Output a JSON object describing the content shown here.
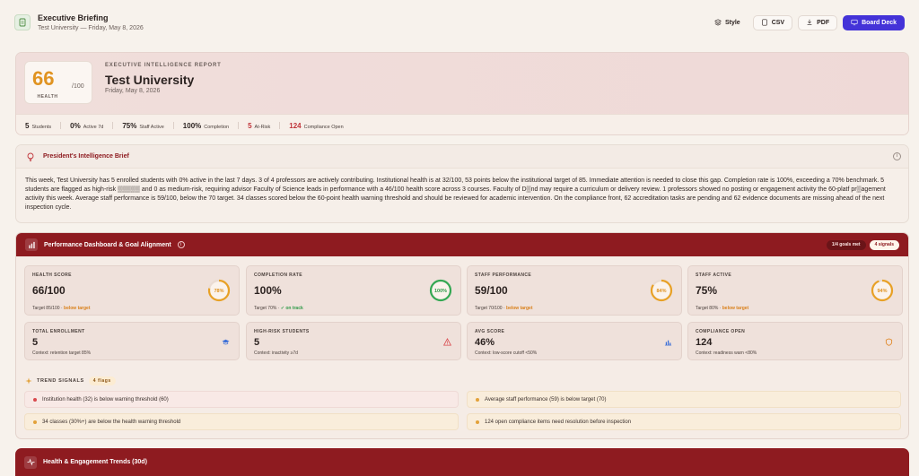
{
  "header": {
    "title": "Executive Briefing",
    "subtitle": "Test University — Friday, May 8, 2026",
    "buttons": {
      "style": "Style",
      "csv": "CSV",
      "pdf": "PDF",
      "board": "Board Deck"
    }
  },
  "report": {
    "score": "66",
    "score_den": "/100",
    "score_label": "HEALTH",
    "kicker": "EXECUTIVE INTELLIGENCE REPORT",
    "title": "Test University",
    "date": "Friday, May 8, 2026",
    "stats": [
      {
        "value": "5",
        "label": "Students"
      },
      {
        "value": "0%",
        "label": "Active 7d"
      },
      {
        "value": "75%",
        "label": "Staff Active"
      },
      {
        "value": "100%",
        "label": "Completion"
      },
      {
        "value": "5",
        "label": "At-Risk"
      },
      {
        "value": "124",
        "label": "Compliance Open"
      }
    ]
  },
  "brief": {
    "title": "President's Intelligence Brief",
    "info": "i",
    "body": "This week, Test University has 5 enrolled students with 0% active in the last 7 days. 3 of 4 professors are actively contributing. Institutional health is at 32/100, 53 points below the institutional target of 85. Immediate attention is needed to close this gap. Completion rate is 100%, exceeding a 70% benchmark. 5 students are flagged as high-risk ▒▒▒▒▒ and 0 as medium-risk, requiring advisor Faculty of Science leads in performance with a 46/100 health score across 3 courses. Faculty of D▒nd may require a curriculum or delivery review. 1 professors showed no posting or engagement activity the 60-platf pr▒agement activity this week. Average staff performance is 59/100, below the 70 target. 34 classes scored below the 60-point health warning threshold and should be reviewed for academic intervention. On the compliance front, 62 accreditation tasks are pending and 62 evidence documents are missing ahead of the next inspection cycle."
  },
  "performance": {
    "title": "Performance Dashboard & Goal Alignment",
    "info": "i",
    "goals_pill": "1/4 goals met",
    "signals_pill": "4 signals",
    "kpis": [
      {
        "label": "HEALTH SCORE",
        "value": "66/100",
        "target_prefix": "Target 85/100 · ",
        "target_status": "below target",
        "status": "warn",
        "ring_text": "78%",
        "ring_value": 78,
        "ring_color": "#e8a126"
      },
      {
        "label": "COMPLETION RATE",
        "value": "100%",
        "target_prefix": "Target 70% · ",
        "target_status": "✓ on track",
        "status": "ok",
        "ring_text": "100%",
        "ring_value": 100,
        "ring_color": "#34a853"
      },
      {
        "label": "STAFF PERFORMANCE",
        "value": "59/100",
        "target_prefix": "Target 70/100 · ",
        "target_status": "below target",
        "status": "warn",
        "ring_text": "84%",
        "ring_value": 84,
        "ring_color": "#e8a126"
      },
      {
        "label": "STAFF ACTIVE",
        "value": "75%",
        "target_prefix": "Target 80% · ",
        "target_status": "below target",
        "status": "warn",
        "ring_text": "94%",
        "ring_value": 94,
        "ring_color": "#e8a126"
      }
    ],
    "context": [
      {
        "label": "TOTAL ENROLLMENT",
        "value": "5",
        "context": "Context: retention target 85%",
        "icon": "graduation-cap-icon",
        "icon_color": "#3b6fd8"
      },
      {
        "label": "HIGH-RISK STUDENTS",
        "value": "5",
        "context": "Context: inactivity ≥7d",
        "icon": "warning-icon",
        "icon_color": "#d9494d"
      },
      {
        "label": "AVG SCORE",
        "value": "46%",
        "context": "Context: low-score cutoff <50%",
        "icon": "bar-chart-icon",
        "icon_color": "#3b6fd8"
      },
      {
        "label": "COMPLIANCE OPEN",
        "value": "124",
        "context": "Context: readiness warn <80%",
        "icon": "shield-icon",
        "icon_color": "#e0831f"
      }
    ],
    "trend_label": "TREND SIGNALS",
    "flags": "4 flags",
    "signals": [
      {
        "text": "Institution health (32) is below warning threshold (60)",
        "tone": "red"
      },
      {
        "text": "Average staff performance (59) is below target (70)",
        "tone": "amber"
      },
      {
        "text": "34 classes (30%+) are below the health warning threshold",
        "tone": "amber"
      },
      {
        "text": "124 open compliance items need resolution before inspection",
        "tone": "amber"
      }
    ]
  },
  "trends": {
    "title": "Health & Engagement Trends (30d)"
  }
}
